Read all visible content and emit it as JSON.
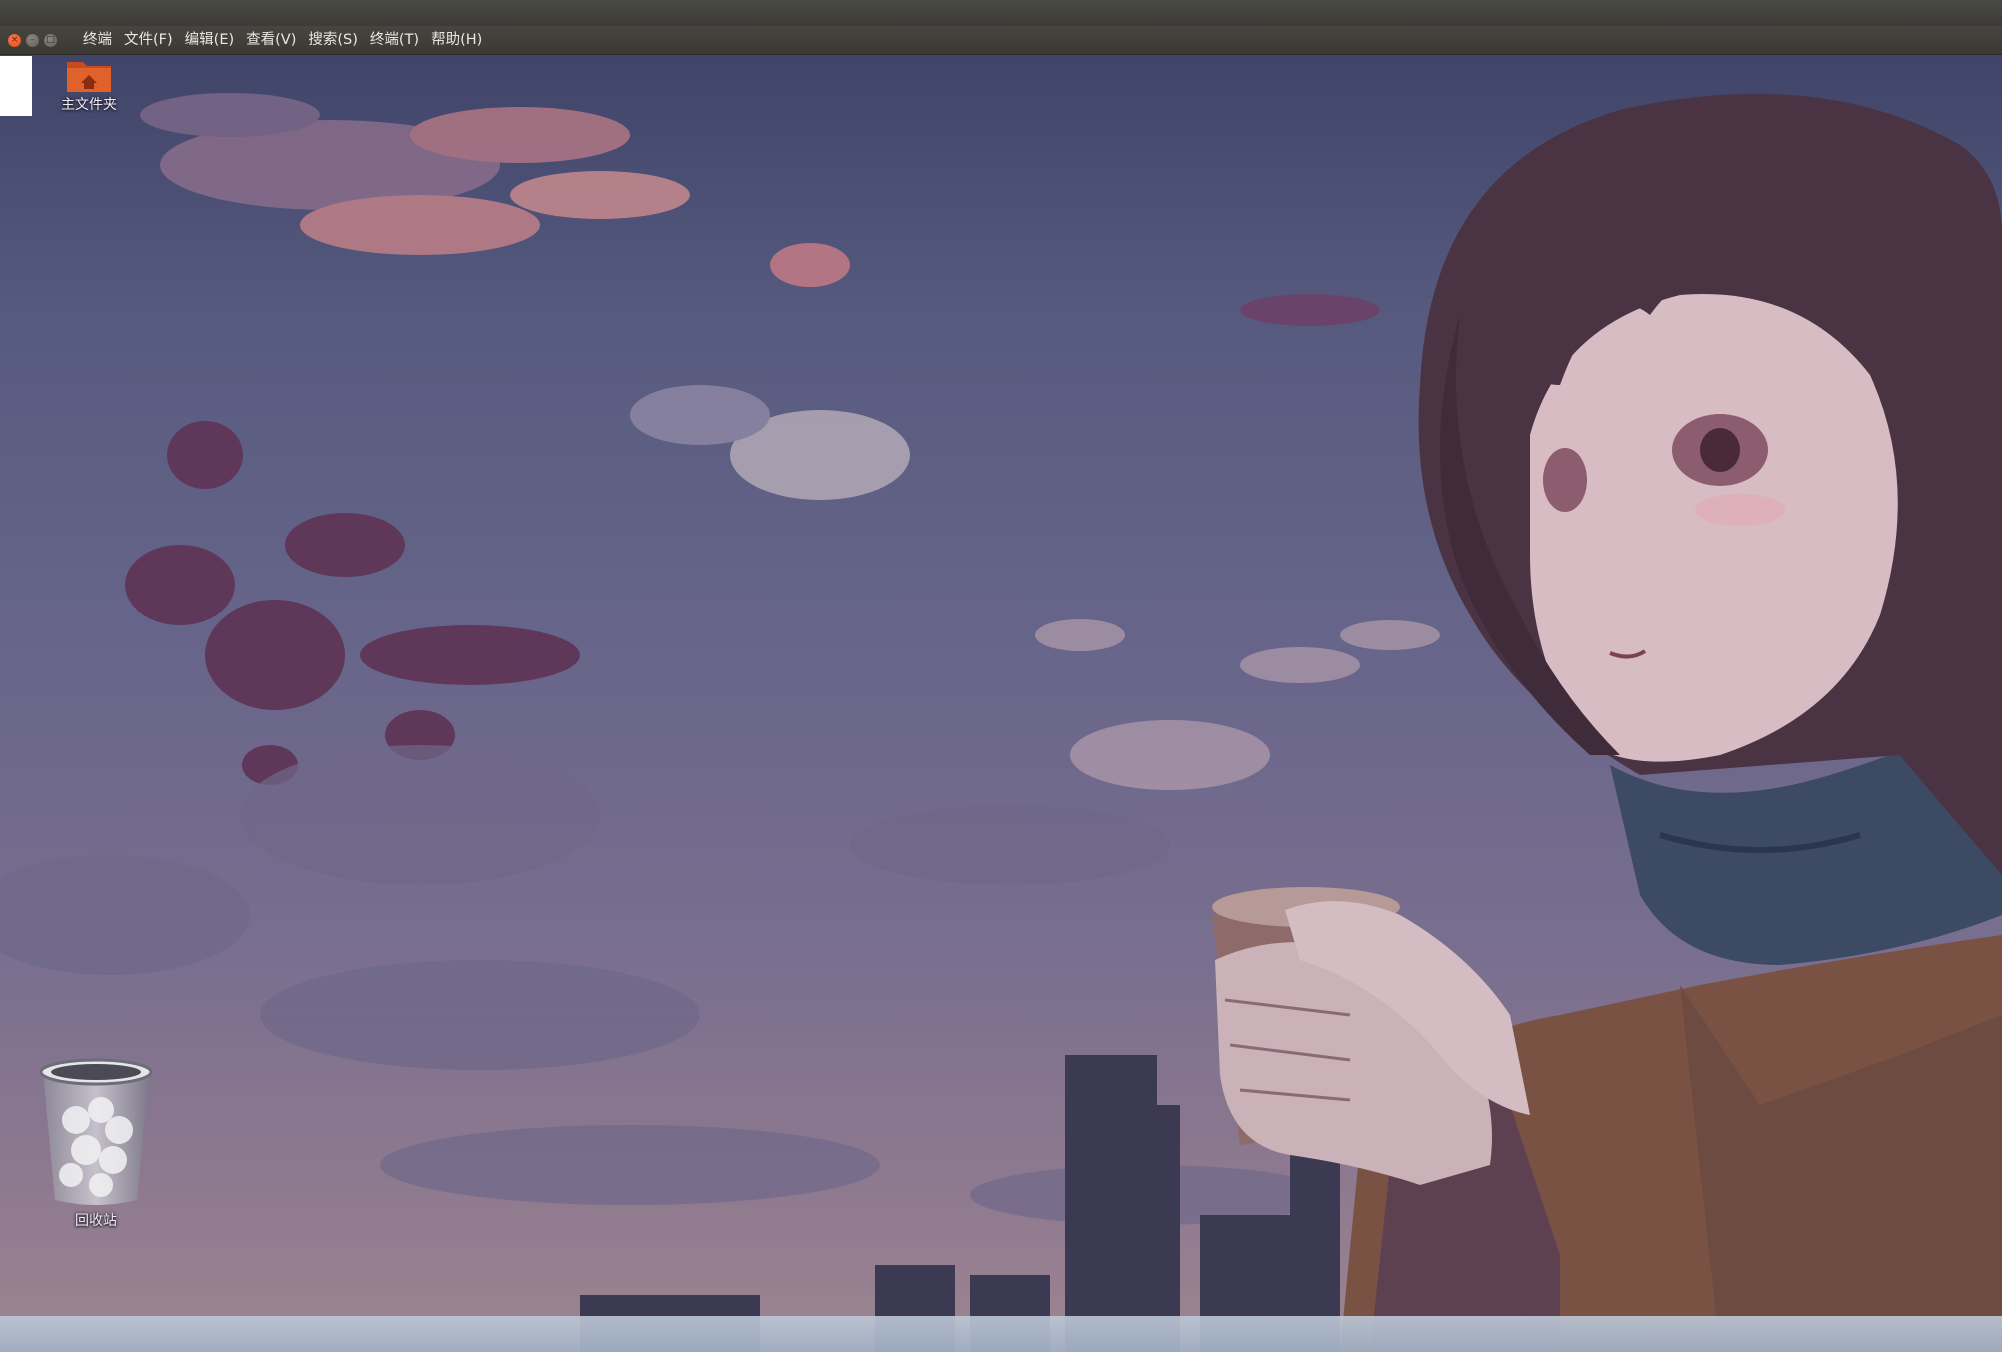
{
  "window": {
    "buttons": [
      {
        "name": "close",
        "glyph": "×",
        "color": "#df4a16"
      },
      {
        "name": "minimize",
        "glyph": "–",
        "color": "#6a6963"
      },
      {
        "name": "maximize",
        "glyph": "□",
        "color": "#6a6963"
      }
    ]
  },
  "menu": {
    "items": [
      "终端",
      "文件(F)",
      "编辑(E)",
      "查看(V)",
      "搜索(S)",
      "终端(T)",
      "帮助(H)"
    ]
  },
  "desktop": {
    "icons": [
      {
        "label": "主文件夹",
        "icon": "home-folder-icon"
      },
      {
        "label": "回收站",
        "icon": "trash-bin-icon"
      }
    ]
  },
  "colors": {
    "accent": "#df4a16",
    "menubar": "#3c3b37",
    "menu_text": "#e8e6df"
  }
}
